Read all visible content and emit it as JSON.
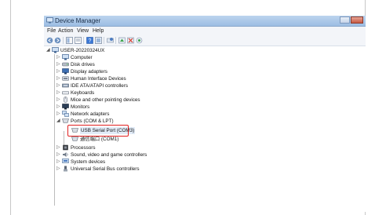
{
  "window": {
    "title": "Device Manager"
  },
  "menubar": {
    "items": [
      "File",
      "Action",
      "View",
      "Help"
    ]
  },
  "toolbar": {
    "icons": [
      "back-icon",
      "forward-icon",
      "show-hide-tree-icon",
      "properties-icon",
      "help-icon",
      "refresh-icon",
      "scan-hardware-icon",
      "update-driver-icon",
      "disable-icon",
      "uninstall-icon"
    ]
  },
  "tree": {
    "root": "USER-20220324UX",
    "categories": [
      "Computer",
      "Disk drives",
      "Display adapters",
      "Human Interface Devices",
      "IDE ATA/ATAPI controllers",
      "Keyboards",
      "Mice and other pointing devices",
      "Monitors",
      "Network adapters",
      "Ports (COM & LPT)",
      "Processors",
      "Sound, video and game controllers",
      "System devices",
      "Universal Serial Bus controllers"
    ],
    "ports_children": [
      "USB Serial Port (COM3)",
      "通信端口 (COM1)"
    ]
  },
  "colors": {
    "highlight": "#e02020",
    "titlebar": "#9cbde3"
  }
}
